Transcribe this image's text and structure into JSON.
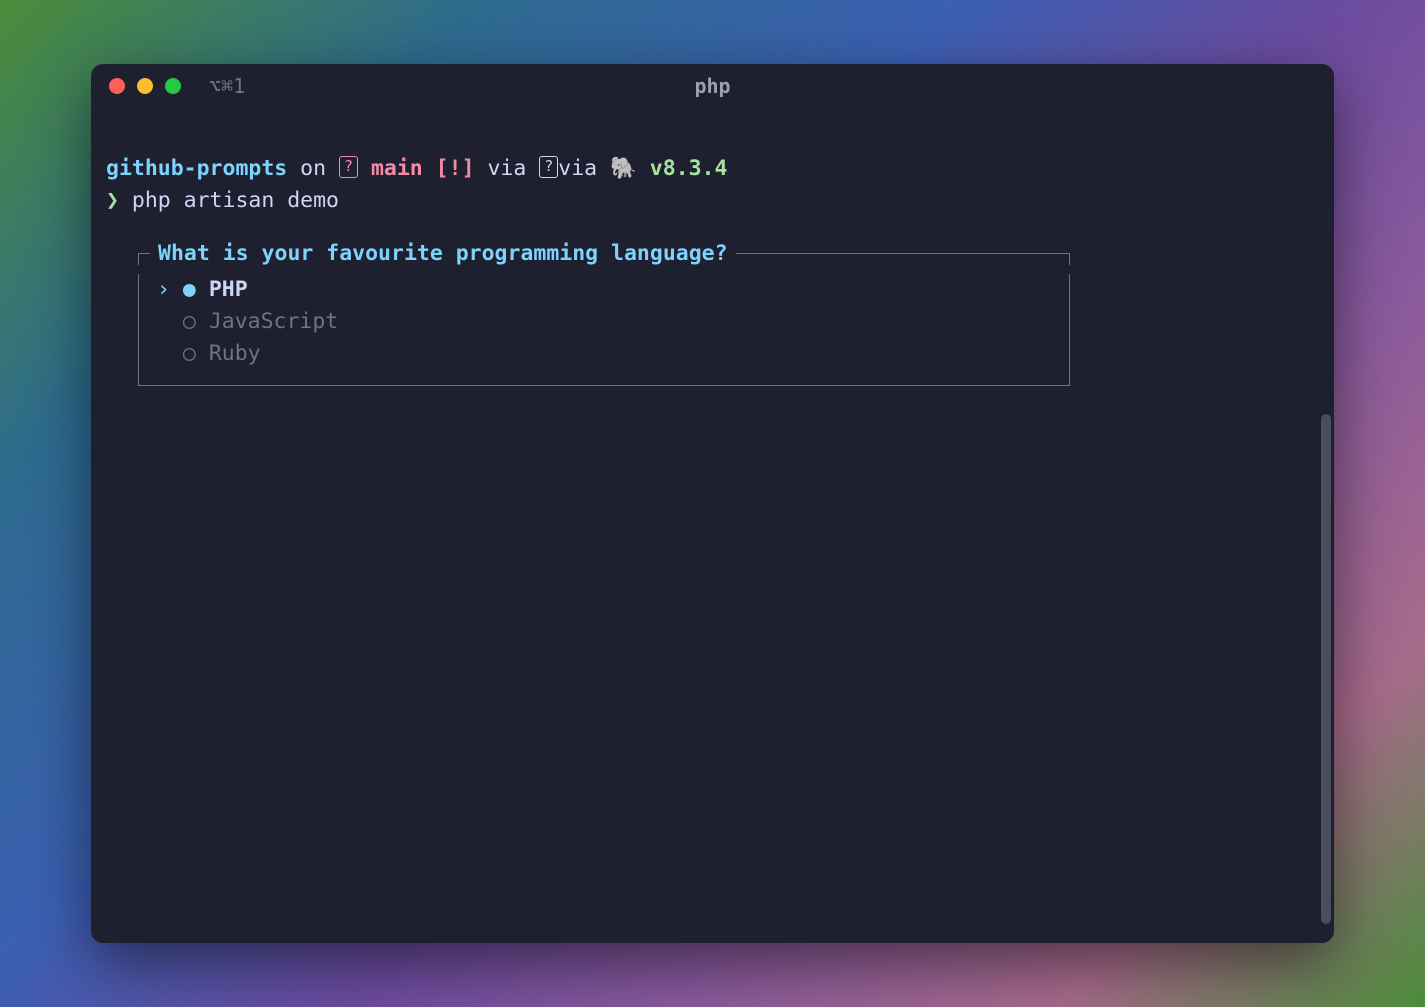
{
  "titlebar": {
    "tab_indicator": "⌥⌘1",
    "title": "php"
  },
  "prompt": {
    "project": "github-prompts",
    "on": " on ",
    "branch_icon": "?",
    "branch": "main",
    "branch_status": " [!]",
    "via1": " via ",
    "via_icon": "?",
    "via2": "via ",
    "elephant": "🐘",
    "version": " v8.3.4"
  },
  "command": {
    "prompt_char": "❯",
    "text": " php artisan demo"
  },
  "select": {
    "question": " What is your favourite programming language? ",
    "options": [
      {
        "label": "PHP",
        "selected": true
      },
      {
        "label": "JavaScript",
        "selected": false
      },
      {
        "label": "Ruby",
        "selected": false
      }
    ]
  }
}
